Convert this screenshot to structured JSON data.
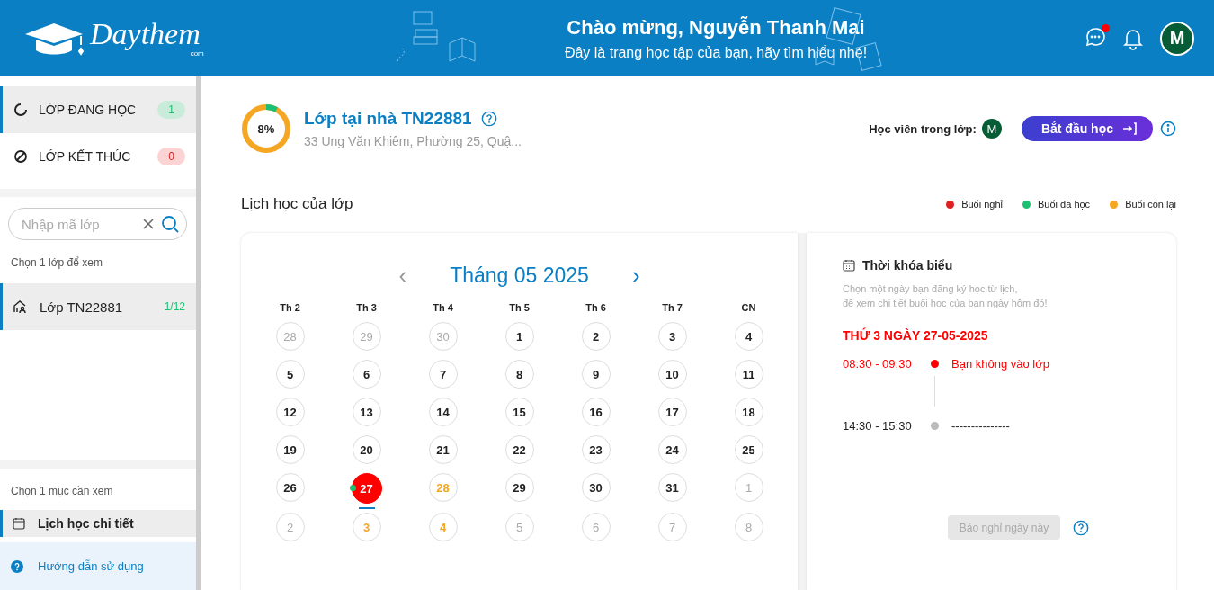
{
  "header": {
    "logo_text": "Daythem",
    "logo_suffix": "com",
    "title": "Chào mừng, Nguyễn Thanh Mai",
    "subtitle": "Đây là trang học tập của bạn, hãy tìm hiểu nhé!",
    "messages_unread": true,
    "avatar_initial": "M"
  },
  "sidebar": {
    "status_tabs": [
      {
        "label": "LỚP ĐANG HỌC",
        "count": "1",
        "kind": "active",
        "selected": true
      },
      {
        "label": "LỚP KẾT THÚC",
        "count": "0",
        "kind": "ended",
        "selected": false
      }
    ],
    "search": {
      "placeholder": "Nhập mã lớp"
    },
    "class_hint": "Chọn 1 lớp để xem",
    "classes": [
      {
        "label": "Lớp TN22881",
        "progress": "1/12",
        "selected": true
      }
    ],
    "section_hint": "Chọn 1 mục cần xem",
    "sections": [
      {
        "label": "Lịch học chi tiết",
        "selected": true
      }
    ],
    "help": "Hướng dẫn sử dụng"
  },
  "class_info": {
    "level": 0.08,
    "percent": "8%",
    "title": "Lớp tại nhà TN22881",
    "address": "33 Ung Văn Khiêm, Phường 25, Quậ...",
    "students_label": "Học viên trong lớp:",
    "student_initial": "M",
    "start_button": "Bắt đầu học"
  },
  "schedule": {
    "title": "Lịch học của lớp",
    "legend": [
      {
        "label": "Buổi nghỉ",
        "color": "#e02020"
      },
      {
        "label": "Buổi đã học",
        "color": "#1dbf73"
      },
      {
        "label": "Buổi còn lại",
        "color": "#f5a623"
      }
    ],
    "calendar": {
      "month": "Tháng 05 2025",
      "prev": "‹",
      "next": "›",
      "weekdays": [
        "Th 2",
        "Th 3",
        "Th 4",
        "Th 5",
        "Th 6",
        "Th 7",
        "CN"
      ],
      "days": [
        {
          "day": "28",
          "kind": "other",
          "selected": false
        },
        {
          "day": "29",
          "kind": "other",
          "selected": false
        },
        {
          "day": "30",
          "kind": "other",
          "selected": false
        },
        {
          "day": "1",
          "kind": "normal",
          "selected": false
        },
        {
          "day": "2",
          "kind": "normal",
          "selected": false
        },
        {
          "day": "3",
          "kind": "normal",
          "selected": false
        },
        {
          "day": "4",
          "kind": "normal",
          "selected": false
        },
        {
          "day": "5",
          "kind": "normal",
          "selected": false
        },
        {
          "day": "6",
          "kind": "normal",
          "selected": false
        },
        {
          "day": "7",
          "kind": "normal",
          "selected": false
        },
        {
          "day": "8",
          "kind": "normal",
          "selected": false
        },
        {
          "day": "9",
          "kind": "normal",
          "selected": false
        },
        {
          "day": "10",
          "kind": "normal",
          "selected": false
        },
        {
          "day": "11",
          "kind": "normal",
          "selected": false
        },
        {
          "day": "12",
          "kind": "normal",
          "selected": false
        },
        {
          "day": "13",
          "kind": "normal",
          "selected": false
        },
        {
          "day": "14",
          "kind": "normal",
          "selected": false
        },
        {
          "day": "15",
          "kind": "normal",
          "selected": false
        },
        {
          "day": "16",
          "kind": "normal",
          "selected": false
        },
        {
          "day": "17",
          "kind": "normal",
          "selected": false
        },
        {
          "day": "18",
          "kind": "normal",
          "selected": false
        },
        {
          "day": "19",
          "kind": "normal",
          "selected": false
        },
        {
          "day": "20",
          "kind": "normal",
          "selected": false
        },
        {
          "day": "21",
          "kind": "normal",
          "selected": false
        },
        {
          "day": "22",
          "kind": "normal",
          "selected": false
        },
        {
          "day": "23",
          "kind": "normal",
          "selected": false
        },
        {
          "day": "24",
          "kind": "normal",
          "selected": false
        },
        {
          "day": "25",
          "kind": "normal",
          "selected": false
        },
        {
          "day": "26",
          "kind": "normal",
          "selected": false
        },
        {
          "day": "27",
          "kind": "absent",
          "selected": true,
          "color": "#1dbf73"
        },
        {
          "day": "28",
          "kind": "remaining",
          "selected": false
        },
        {
          "day": "29",
          "kind": "normal",
          "selected": false
        },
        {
          "day": "30",
          "kind": "normal",
          "selected": false
        },
        {
          "day": "31",
          "kind": "normal",
          "selected": false
        },
        {
          "day": "1",
          "kind": "other",
          "selected": false
        },
        {
          "day": "2",
          "kind": "other",
          "selected": false
        },
        {
          "day": "3",
          "kind": "remaining",
          "selected": false
        },
        {
          "day": "4",
          "kind": "remaining",
          "selected": false
        },
        {
          "day": "5",
          "kind": "other",
          "selected": false
        },
        {
          "day": "6",
          "kind": "other",
          "selected": false
        },
        {
          "day": "7",
          "kind": "other",
          "selected": false
        },
        {
          "day": "8",
          "kind": "other",
          "selected": false
        }
      ]
    },
    "timetable": {
      "title": "Thời khóa biểu",
      "hint_lines": [
        "Chọn một ngày bạn đăng ký học từ lịch,",
        "để xem chi tiết buổi học của bạn ngày hôm đó!"
      ],
      "date": "THỨ 3 NGÀY 27-05-2025",
      "sessions": [
        {
          "time": "08:30 - 09:30",
          "kind": "absent",
          "text": "Bạn không vào lớp"
        },
        {
          "time": "14:30 - 15:30",
          "kind": "none",
          "text": "---------------"
        }
      ],
      "report_button": {
        "label": "Báo nghỉ ngày này",
        "disabled": true
      }
    }
  }
}
